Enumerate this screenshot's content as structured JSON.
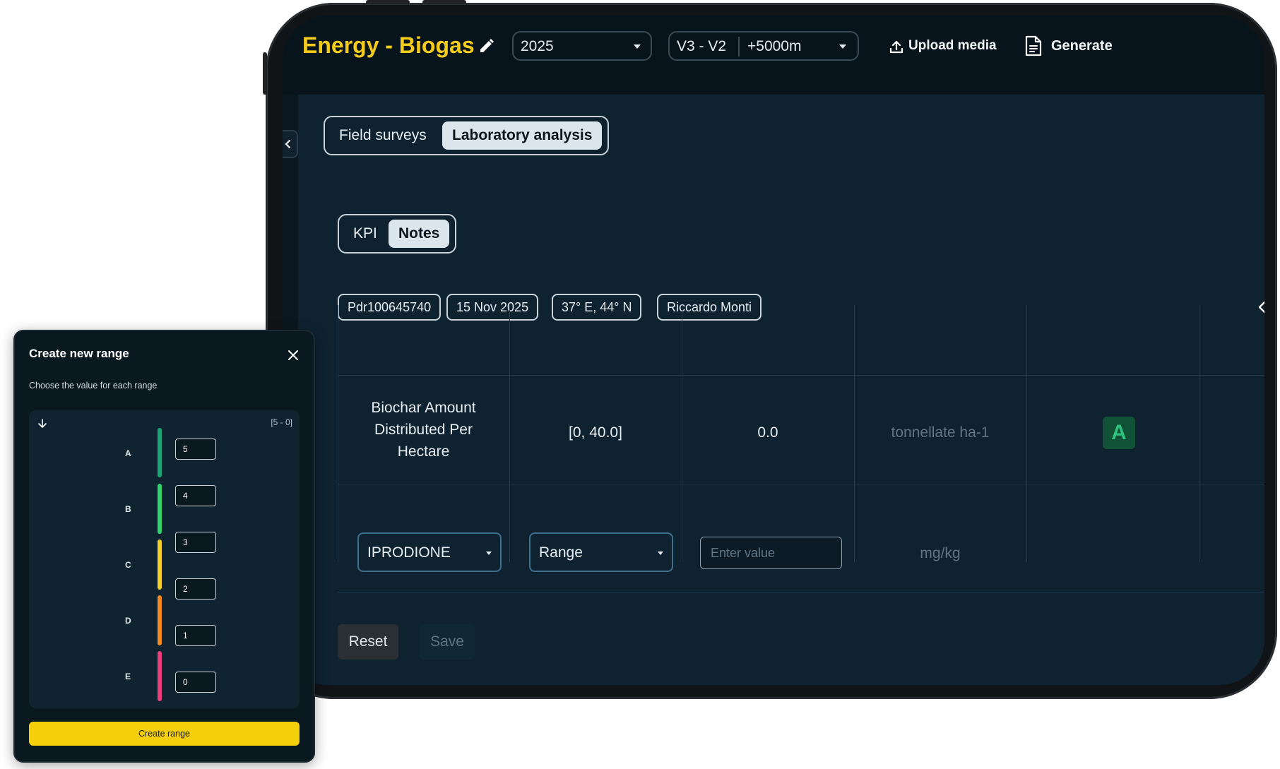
{
  "header": {
    "title": "Energy - Biogas",
    "year": "2025",
    "distance_left": "V3 - V2",
    "distance_right": "+5000m",
    "upload_label": "Upload media",
    "generate_label": "Generate"
  },
  "main_tabs": [
    {
      "label": "Field surveys",
      "active": false
    },
    {
      "label": "Laboratory analysis",
      "active": true
    }
  ],
  "sub_tabs": [
    {
      "label": "KPI",
      "active": false
    },
    {
      "label": "Notes",
      "active": true
    }
  ],
  "chips": [
    "Pdr100645740",
    "15 Nov 2025",
    "37° E, 44° N",
    "Riccardo Monti"
  ],
  "table": {
    "row1": {
      "parameter_line1": "Biochar Amount",
      "parameter_line2": "Distributed Per",
      "parameter_line3": "Hectare",
      "range": "[0, 40.0]",
      "value": "0.0",
      "unit": "tonnellate ha-1",
      "grade": "A"
    },
    "row2": {
      "parameter": "IPRODIONE",
      "type": "Range",
      "value_placeholder": "Enter value",
      "unit": "mg/kg"
    }
  },
  "actions": {
    "reset": "Reset",
    "save": "Save"
  },
  "modal": {
    "title": "Create new range",
    "subtitle": "Choose the value for each range",
    "range_badge": "[5 - 0]",
    "grades": [
      {
        "label": "A",
        "color": "#17a673"
      },
      {
        "label": "B",
        "color": "#2fd46f"
      },
      {
        "label": "C",
        "color": "#f4d12a"
      },
      {
        "label": "D",
        "color": "#f58a1f"
      },
      {
        "label": "E",
        "color": "#ec3d79"
      }
    ],
    "thresholds": [
      "5",
      "4",
      "3",
      "2",
      "1",
      "0"
    ],
    "create_label": "Create range"
  },
  "colors": {
    "accent": "#f5cb1c",
    "background": "#0e2230"
  }
}
